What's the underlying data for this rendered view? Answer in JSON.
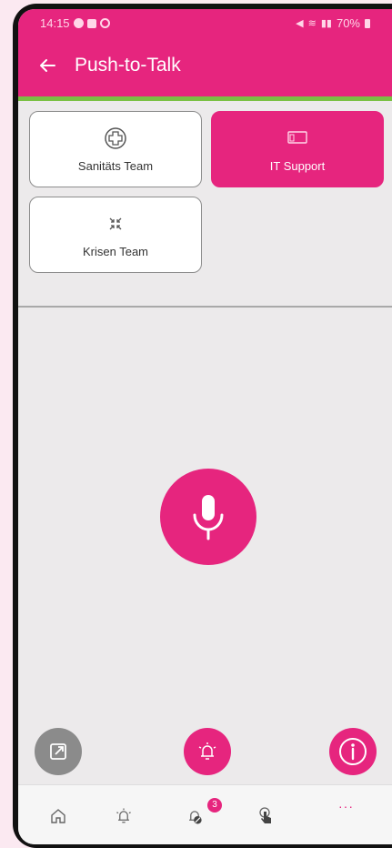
{
  "status_bar": {
    "time": "14:15",
    "battery": "70%"
  },
  "appbar": {
    "title": "Push-to-Talk"
  },
  "groups": [
    {
      "label": "Sanitäts Team",
      "icon": "medical-cross-icon",
      "active": false
    },
    {
      "label": "IT Support",
      "icon": "laptop-icon",
      "active": true
    },
    {
      "label": "Krisen Team",
      "icon": "collapse-arrows-icon",
      "active": false
    }
  ],
  "bottom_nav": {
    "items": [
      "home-icon",
      "alarm-bell-icon",
      "alarm-off-icon",
      "touch-icon",
      "more-icon"
    ],
    "badge": "3",
    "more": "···"
  },
  "colors": {
    "accent": "#e6257e",
    "accent_line": "#7ac043",
    "background": "#eceaeb"
  }
}
